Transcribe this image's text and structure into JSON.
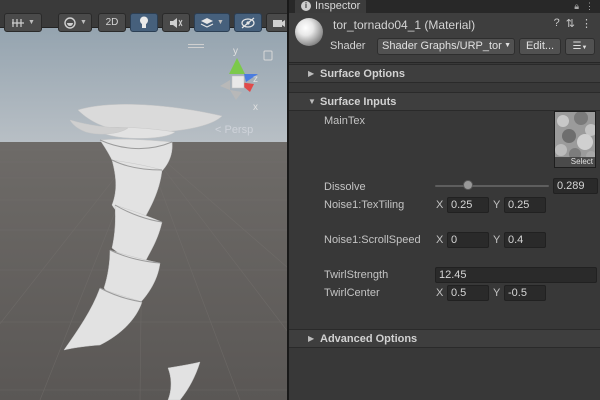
{
  "scene": {
    "toolbar": {
      "mode_2d_label": "2D"
    },
    "camera_label": "< Persp",
    "gizmo": {
      "y_label": "y",
      "x_label": "x",
      "z_label": "z"
    },
    "colors": {
      "sky_top": "#8fa0ad",
      "horizon": "#b6bec4",
      "ground": "#5f5d5b",
      "gizmo_x": "#e04a4a",
      "gizmo_y": "#7cc94b",
      "gizmo_z": "#4a7ce0"
    }
  },
  "inspector": {
    "tab_label": "Inspector",
    "material_title": "tor_tornado04_1 (Material)",
    "shader_label": "Shader",
    "shader_value": "Shader Graphs/URP_tor",
    "edit_button_label": "Edit...",
    "sections": {
      "surface_options": "Surface Options",
      "surface_inputs": "Surface Inputs",
      "advanced_options": "Advanced Options"
    },
    "properties": {
      "main_tex_label": "MainTex",
      "texture_select_label": "Select",
      "dissolve_label": "Dissolve",
      "dissolve_value": "0.289",
      "dissolve_fraction": 0.289,
      "noise1_textiling_label": "Noise1:TexTiling",
      "noise1_textiling_x": "0.25",
      "noise1_textiling_y": "0.25",
      "noise1_scrollspeed_label": "Noise1:ScrollSpeed",
      "noise1_scrollspeed_x": "0",
      "noise1_scrollspeed_y": "0.4",
      "twirl_strength_label": "TwirlStrength",
      "twirl_strength_value": "12.45",
      "twirl_center_label": "TwirlCenter",
      "twirl_center_x": "0.5",
      "twirl_center_y": "-0.5"
    },
    "axis_labels": {
      "x": "X",
      "y": "Y"
    }
  }
}
